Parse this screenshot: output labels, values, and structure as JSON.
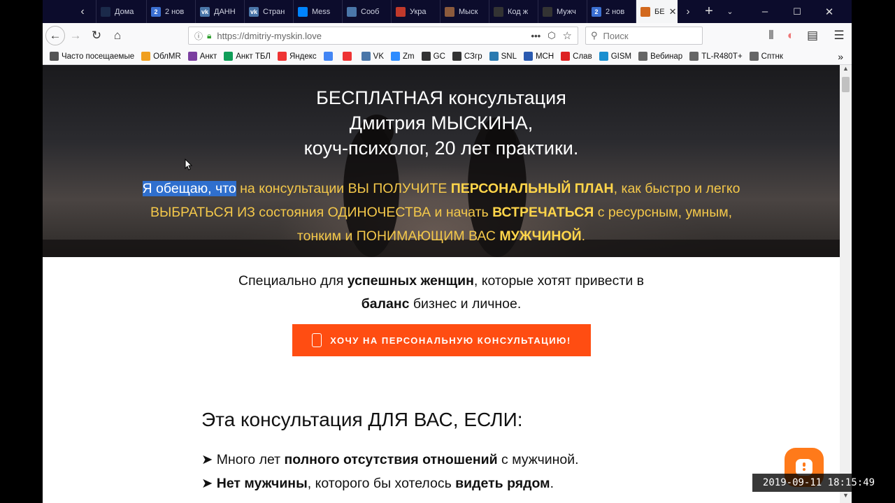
{
  "tabs": [
    {
      "label": "Дома",
      "color": "#1b2a4a",
      "glyph": ""
    },
    {
      "label": "2 нов",
      "color": "#3b6fd1",
      "glyph": "2"
    },
    {
      "label": "ДАНН",
      "color": "#4a76a8",
      "glyph": "vk"
    },
    {
      "label": "Стран",
      "color": "#4a76a8",
      "glyph": "vk"
    },
    {
      "label": "Mess",
      "color": "#0084ff",
      "glyph": ""
    },
    {
      "label": "Сооб",
      "color": "#4a76a8",
      "glyph": ""
    },
    {
      "label": "Укра",
      "color": "#c0392b",
      "glyph": ""
    },
    {
      "label": "Мыск",
      "color": "#8b5a3c",
      "glyph": ""
    },
    {
      "label": "Код ж",
      "color": "#333",
      "glyph": ""
    },
    {
      "label": "Мужч",
      "color": "#333",
      "glyph": ""
    },
    {
      "label": "2 нов",
      "color": "#3b6fd1",
      "glyph": "2"
    },
    {
      "label": "БЕ",
      "color": "#d2691e",
      "glyph": "",
      "active": true
    }
  ],
  "url": "https://dmitriy-myskin.love",
  "search_placeholder": "Поиск",
  "bookmarks": [
    {
      "label": "Часто посещаемые",
      "color": "#555"
    },
    {
      "label": "ОблMR",
      "color": "#f0a020"
    },
    {
      "label": "Анкт",
      "color": "#7b3fa0"
    },
    {
      "label": "Анкт ТБЛ",
      "color": "#0f9d58"
    },
    {
      "label": "Яндекс",
      "color": "#e33"
    },
    {
      "label": "",
      "color": "#4285f4"
    },
    {
      "label": "",
      "color": "#e33"
    },
    {
      "label": "VK",
      "color": "#4a76a8"
    },
    {
      "label": "Zm",
      "color": "#2d8cff"
    },
    {
      "label": "GC",
      "color": "#333"
    },
    {
      "label": "СЗгр",
      "color": "#333"
    },
    {
      "label": "SNL",
      "color": "#2a7ab0"
    },
    {
      "label": "МСН",
      "color": "#2a5ab0"
    },
    {
      "label": "Слав",
      "color": "#d22"
    },
    {
      "label": "GISM",
      "color": "#1a8fd0"
    },
    {
      "label": "Вебинар",
      "color": "#666"
    },
    {
      "label": "TL-R480T+",
      "color": "#666"
    },
    {
      "label": "Сптнк",
      "color": "#666"
    }
  ],
  "hero": {
    "title_line1": "БЕСПЛАТНАЯ консультация",
    "title_line2": "Дмитрия МЫСКИНА,",
    "title_line3": "коуч-психолог, 20 лет практики.",
    "pitch_selected": "Я обещаю, что",
    "pitch_1": " на консультации ВЫ ПОЛУЧИТЕ ",
    "pitch_1b": "ПЕРСОНАЛЬНЫЙ ПЛАН",
    "pitch_2": ", как быстро и легко ВЫБРАТЬСЯ ИЗ состояния ОДИНОЧЕСТВА и начать ",
    "pitch_2b": "ВСТРЕЧАТЬСЯ",
    "pitch_3": " с ресурсным, умным, тонким и ПОНИМАЮЩИМ ВАС ",
    "pitch_3b": "МУЖЧИНОЙ",
    "pitch_4": "."
  },
  "sub": {
    "a": "Специально для ",
    "b": "успешных женщин",
    "c": ", которые хотят привести в",
    "d": "баланс",
    "e": " бизнес и личное."
  },
  "cta_label": "ХОЧУ НА ПЕРСОНАЛЬНУЮ КОНСУЛЬТАЦИЮ!",
  "section_title": "Эта консультация ДЛЯ ВАС, ЕСЛИ:",
  "list": {
    "i1a": "Много лет ",
    "i1b": "полного отсутствия отношений",
    "i1c": " с мужчиной.",
    "i2b": "Нет мужчины",
    "i2c": ", которого бы хотелось ",
    "i2d": "видеть рядом",
    "i2e": "."
  },
  "timestamp": "2019-09-11  18:15:49"
}
